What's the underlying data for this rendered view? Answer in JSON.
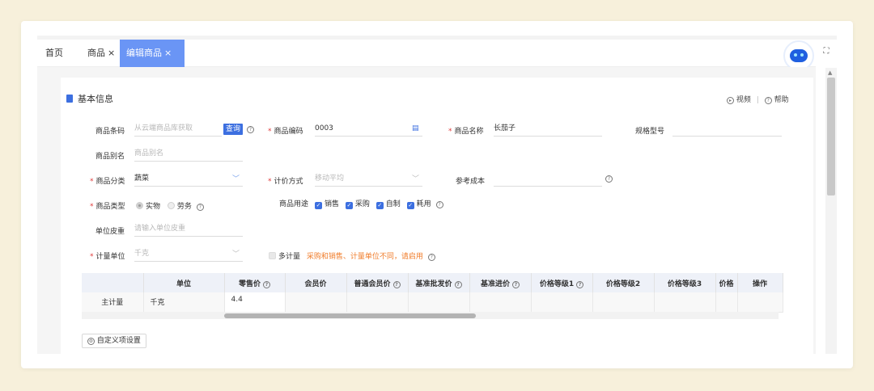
{
  "tabs": [
    {
      "label": "首页",
      "closable": false,
      "active": false
    },
    {
      "label": "商品",
      "closable": true,
      "active": false
    },
    {
      "label": "编辑商品",
      "closable": true,
      "active": true
    }
  ],
  "close_glyph": "×",
  "section": {
    "title": "基本信息",
    "video_link": "视频",
    "help_link": "帮助"
  },
  "form": {
    "barcode": {
      "label": "商品条码",
      "placeholder": "从云端商品库获取",
      "query_button": "查询"
    },
    "code": {
      "label": "商品编码",
      "value": "0003"
    },
    "name": {
      "label": "商品名称",
      "value": "长茄子"
    },
    "spec": {
      "label": "规格型号",
      "value": ""
    },
    "alias": {
      "label": "商品别名",
      "placeholder": "商品别名"
    },
    "category": {
      "label": "商品分类",
      "value": "蔬菜"
    },
    "pricing": {
      "label": "计价方式",
      "placeholder": "移动平均"
    },
    "ref_cost": {
      "label": "参考成本",
      "value": ""
    },
    "type": {
      "label": "商品类型",
      "options": [
        "实物",
        "劳务"
      ],
      "selected": "实物"
    },
    "usage": {
      "label": "商品用途",
      "options": [
        "销售",
        "采购",
        "自制",
        "耗用"
      ]
    },
    "tare": {
      "label": "单位皮重",
      "placeholder": "请输入单位皮重"
    },
    "unit": {
      "label": "计量单位",
      "placeholder": "千克"
    },
    "multi_unit": {
      "label": "多计量",
      "hint": "采购和销售、计量单位不同，请启用"
    }
  },
  "table": {
    "headers": [
      "",
      "单位",
      "零售价",
      "会员价",
      "普通会员价",
      "基准批发价",
      "基准进价",
      "价格等级1",
      "价格等级2",
      "价格等级3",
      "价格",
      "操作"
    ],
    "help_cols": [
      2,
      4,
      5,
      6,
      7
    ],
    "rows": [
      [
        "主计量",
        "千克",
        "4.4",
        "",
        "",
        "",
        "",
        "",
        "",
        "",
        "",
        ""
      ]
    ]
  },
  "custom_button": "自定义项设置",
  "icons": {
    "help": "question-circle-icon",
    "barcode": "scan-icon",
    "video": "play-circle-icon",
    "chevron": "chevron-down-icon",
    "fullscreen": "fullscreen-icon"
  },
  "colors": {
    "accent": "#3c6fe0",
    "active_tab": "#6a95f5",
    "warning": "#f07c2a",
    "required": "#e03a3a"
  }
}
